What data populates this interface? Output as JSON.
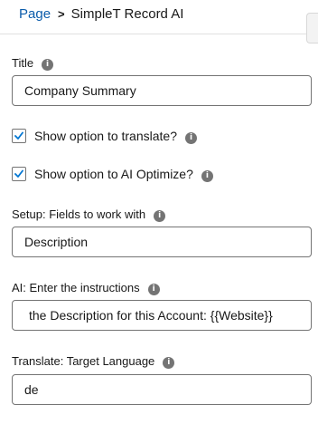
{
  "breadcrumb": {
    "parent": "Page",
    "separator": ">",
    "current": "SimpleT Record AI"
  },
  "info_glyph": "i",
  "fields": {
    "title": {
      "label": "Title",
      "value": "Company Summary"
    },
    "show_translate": {
      "label": "Show option to translate?",
      "checked": true
    },
    "show_ai_optimize": {
      "label": "Show option to AI Optimize?",
      "checked": true
    },
    "setup_fields": {
      "label": "Setup: Fields to work with",
      "value": "Description"
    },
    "ai_instructions": {
      "label": "AI: Enter the instructions",
      "value": "the Description for this Account: {{Website}}"
    },
    "target_language": {
      "label": "Translate: Target Language",
      "value": "de"
    }
  },
  "colors": {
    "link": "#0b5cab",
    "check": "#0176d3",
    "info_icon": "#747474",
    "border": "#747474"
  },
  "icons": [
    "info-icon",
    "checkmark-icon"
  ]
}
